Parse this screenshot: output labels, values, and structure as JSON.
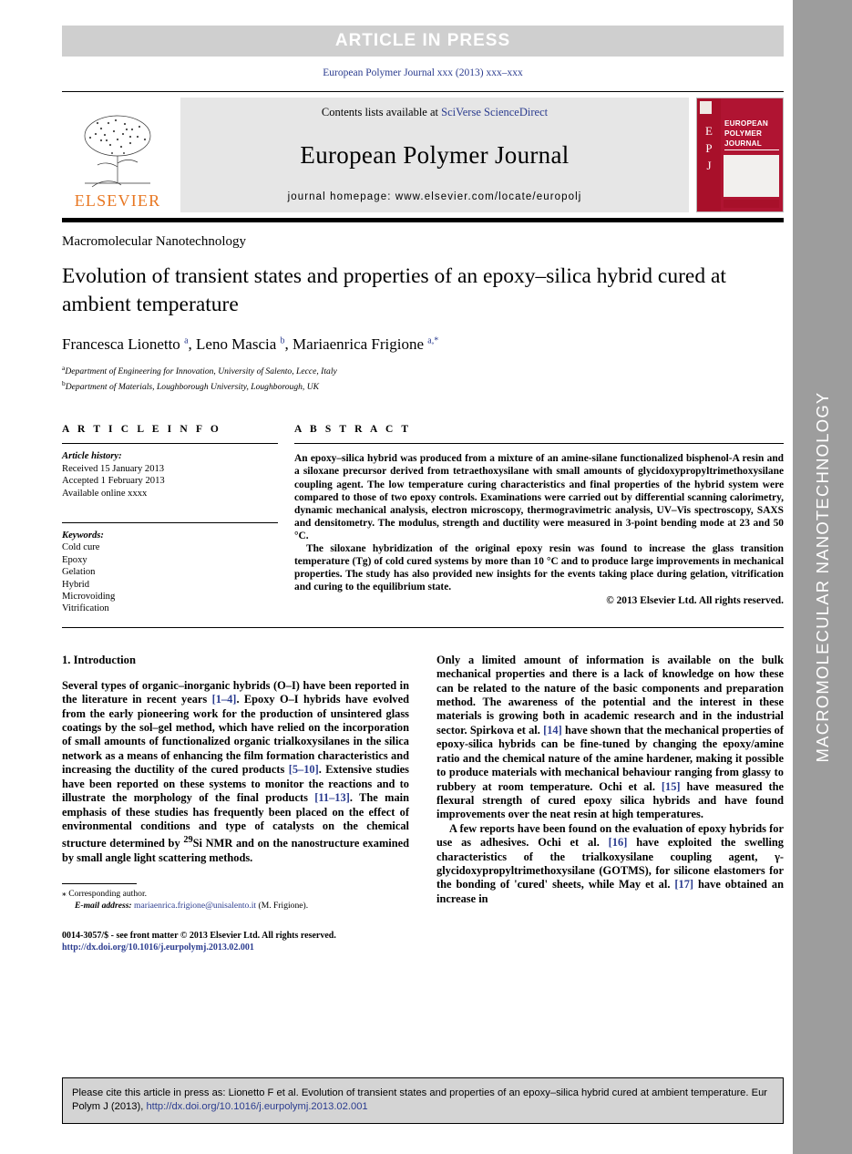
{
  "banner": {
    "article_in_press": "ARTICLE  IN  PRESS"
  },
  "journal_ref": "European Polymer Journal xxx (2013) xxx–xxx",
  "masthead": {
    "publisher_name": "ELSEVIER",
    "contents_prefix": "Contents lists available at ",
    "contents_link": "SciVerse ScienceDirect",
    "journal_title": "European Polymer Journal",
    "homepage": "journal homepage: www.elsevier.com/locate/europolj",
    "cover": {
      "letters": [
        "E",
        "P",
        "J"
      ],
      "name_lines": [
        "EUROPEAN",
        "POLYMER",
        "JOURNAL"
      ]
    }
  },
  "section_name": "Macromolecular Nanotechnology",
  "title": "Evolution of transient states and properties of an epoxy–silica hybrid cured at ambient temperature",
  "authors_html": "Francesca Lionetto <sup>a</sup>, Leno Mascia <sup>b</sup>, Mariaenrica Frigione <sup>a,*</sup>",
  "affiliations": [
    {
      "marker": "a",
      "text": "Department of Engineering for Innovation, University of Salento, Lecce, Italy"
    },
    {
      "marker": "b",
      "text": "Department of Materials, Loughborough University, Loughborough, UK"
    }
  ],
  "article_info": {
    "heading": "A R T I C L E    I N F O",
    "history_label": "Article history:",
    "history": [
      "Received 15 January 2013",
      "Accepted 1 February 2013",
      "Available online xxxx"
    ],
    "keywords_label": "Keywords:",
    "keywords": [
      "Cold cure",
      "Epoxy",
      "Gelation",
      "Hybrid",
      "Microvoiding",
      "Vitrification"
    ]
  },
  "abstract": {
    "heading": "A B S T R A C T",
    "paragraphs": [
      "An epoxy–silica hybrid was produced from a mixture of an amine-silane functionalized bisphenol-A resin and a siloxane precursor derived from tetraethoxysilane with small amounts of glycidoxypropyltrimethoxysilane coupling agent. The low temperature curing characteristics and final properties of the hybrid system were compared to those of two epoxy controls. Examinations were carried out by differential scanning calorimetry, dynamic mechanical analysis, electron microscopy, thermogravimetric analysis, UV–Vis spectroscopy, SAXS and densitometry. The modulus, strength and ductility were measured in 3-point bending mode at 23 and 50 °C.",
      "The siloxane hybridization of the original epoxy resin was found to increase the glass transition temperature (Tg) of cold cured systems by more than 10 °C and to produce large improvements in mechanical properties. The study has also provided new insights for the events taking place during gelation, vitrification and curing to the equilibrium state."
    ],
    "copyright": "© 2013 Elsevier Ltd. All rights reserved."
  },
  "body": {
    "left_heading": "1. Introduction",
    "left_paragraph_1_html": "Several types of organic–inorganic hybrids (O–I) have been reported in the literature in recent years <span class=\"ref\">[1–4]</span>. Epoxy O–I hybrids have evolved from the early pioneering work for the production of unsintered glass coatings by the sol–gel method, which have relied on the incorporation of small amounts of functionalized organic trialkoxysilanes in the silica network as a means of enhancing the film formation characteristics and increasing the ductility of the cured products <span class=\"ref\">[5–10]</span>. Extensive studies have been reported on these systems to monitor the reactions and to illustrate the morphology of the final products <span class=\"ref\">[11–13]</span>. The main emphasis of these studies has frequently been placed on the effect of environmental conditions and type of catalysts on the chemical structure determined by <sup>29</sup>Si NMR and on the nanostructure examined by small angle light scattering methods.",
    "right_paragraph_1_html": "Only a limited amount of information is available on the bulk mechanical properties and there is a lack of knowledge on how these can be related to the nature of the basic components and preparation method. The awareness of the potential and the interest in these materials is growing both in academic research and in the industrial sector. Spirkova et al. <span class=\"ref\">[14]</span> have shown that the mechanical properties of epoxy-silica hybrids can be fine-tuned by changing the epoxy/amine ratio and the chemical nature of the amine hardener, making it possible to produce materials with mechanical behaviour ranging from glassy to rubbery at room temperature. Ochi et al. <span class=\"ref\">[15]</span> have measured the flexural strength of cured epoxy silica hybrids and have found improvements over the neat resin at high temperatures.",
    "right_paragraph_2_html": "A few reports have been found on the evaluation of epoxy hybrids for use as adhesives. Ochi et al. <span class=\"ref\">[16]</span> have exploited the swelling characteristics of the trialkoxysilane coupling agent, γ-glycidoxypropyltrimethoxysilane (GOTMS), for silicone elastomers for the bonding of 'cured' sheets, while May et al. <span class=\"ref\">[17]</span> have obtained an increase in"
  },
  "footnote": {
    "corresponding_marker": "⁎",
    "corresponding_text": "Corresponding author.",
    "email_label": "E-mail address:",
    "email": "mariaenrica.frigione@unisalento.it",
    "email_suffix": "(M. Frigione)."
  },
  "issn_line": {
    "text": "0014-3057/$ - see front matter © 2013 Elsevier Ltd. All rights reserved.",
    "doi": "http://dx.doi.org/10.1016/j.eurpolymj.2013.02.001"
  },
  "cite_box": {
    "text_before": "Please cite this article in press as: Lionetto F et al. Evolution of transient states and properties of an epoxy–silica hybrid cured at ambient temperature. Eur Polym J (2013), ",
    "link": "http://dx.doi.org/10.1016/j.eurpolymj.2013.02.001"
  },
  "sidebar": {
    "vertical_text": "MACROMOLECULAR NANOTECHNOLOGY"
  },
  "colors": {
    "link": "#2b3c8f",
    "banner_bg": "#cfcfcf",
    "sidebar_bg": "#9d9d9d",
    "cover_red": "#b01432",
    "elsevier_orange": "#e87722"
  }
}
